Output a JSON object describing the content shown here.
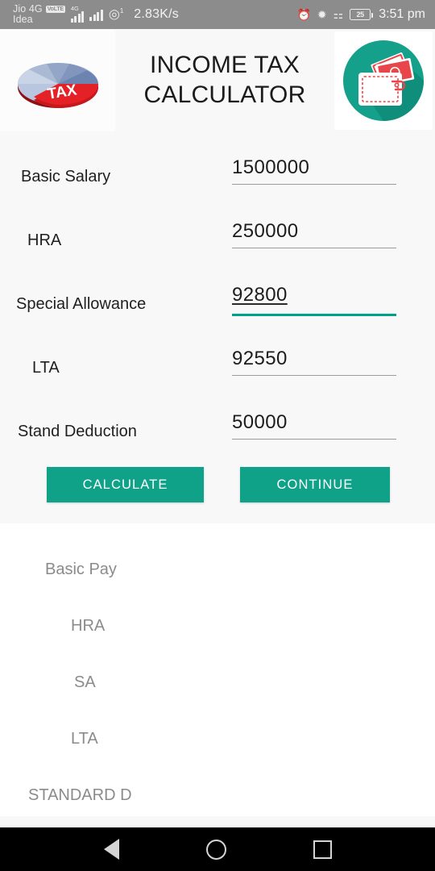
{
  "statusbar": {
    "carrier_primary": "Jio 4G",
    "volte_badge": "VoLTE",
    "carrier_secondary": "Idea",
    "network_type": "4G",
    "hotspot_superscript": "1",
    "data_speed": "2.83K/s",
    "battery_percent": "25",
    "time": "3:51 pm",
    "icons": [
      "alarm-icon",
      "bluetooth-icon",
      "vibrate-icon",
      "battery-icon"
    ]
  },
  "header": {
    "title": "INCOME TAX CALCULATOR",
    "title_line1": "INCOME TAX",
    "title_line2": "CALCULATOR",
    "left_logo": "tax-pie-chart-icon",
    "left_logo_text": "TAX",
    "right_logo": "wallet-money-icon"
  },
  "form": {
    "fields": [
      {
        "label": "Basic Salary",
        "value": "1500000",
        "focused": false,
        "spellcheck_underline": false
      },
      {
        "label": "HRA",
        "value": "250000",
        "focused": false,
        "spellcheck_underline": false
      },
      {
        "label": "Special Allowance",
        "value": "92800",
        "focused": true,
        "spellcheck_underline": true
      },
      {
        "label": "LTA",
        "value": "92550",
        "focused": false,
        "spellcheck_underline": false
      },
      {
        "label": "Stand Deduction",
        "value": "50000",
        "focused": false,
        "spellcheck_underline": false
      }
    ],
    "buttons": {
      "calculate": "CALCULATE",
      "continue": "CONTINUE"
    }
  },
  "results": {
    "rows": [
      {
        "label": "Basic Pay"
      },
      {
        "label": "HRA"
      },
      {
        "label": "SA"
      },
      {
        "label": "LTA"
      },
      {
        "label": "STANDARD D"
      }
    ]
  },
  "navbar": {
    "back": "back-triangle-icon",
    "home": "home-circle-icon",
    "recents": "recents-square-icon"
  },
  "colors": {
    "accent_teal": "#10a289",
    "focus_underline": "#00a18b",
    "statusbar_bg": "#8c8c8c",
    "card_bg": "#f8f8f8",
    "label_text": "#1f1f1f",
    "result_text": "#8b8b8b",
    "navbar_bg": "#000000"
  }
}
